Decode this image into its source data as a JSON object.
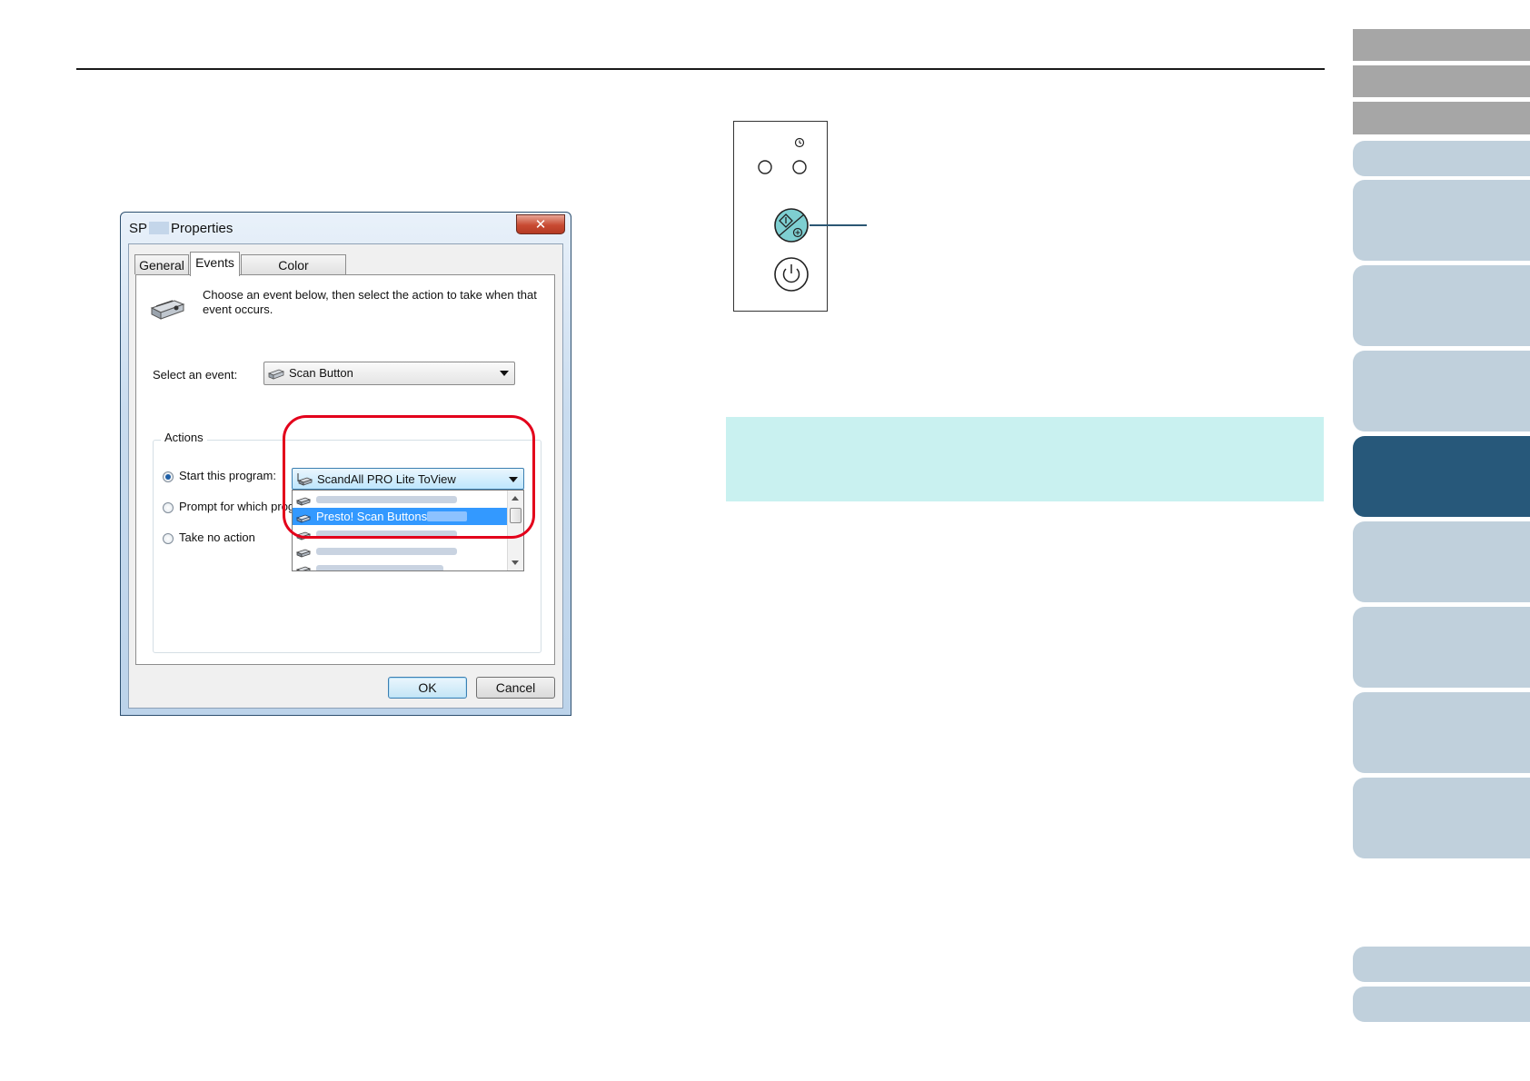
{
  "dialog": {
    "title_prefix": "SP",
    "title_suffix": "Properties",
    "close_label": "✕",
    "tabs": [
      {
        "label": "General"
      },
      {
        "label": "Events"
      },
      {
        "label": "Color Management"
      }
    ],
    "description": "Choose an event below, then select the action to take when that event occurs.",
    "select_event_label": "Select an event:",
    "event_value": "Scan Button",
    "actions_legend": "Actions",
    "radio_start": "Start this program:",
    "radio_prompt": "Prompt for which prog",
    "radio_none": "Take no action",
    "program_value": "ScandAll PRO Lite ToView",
    "dropdown_selected": "Presto! Scan Buttons",
    "ok_label": "OK",
    "cancel_label": "Cancel"
  },
  "colors": {
    "highlight_ring": "#e3001b",
    "note_background": "#c9f1f0",
    "nav_active": "#27587a",
    "nav_inactive": "#c0d0dc",
    "nav_gray": "#a6a6a6"
  },
  "icons": {
    "scanner": "scanner-icon",
    "start_button": "scan-start-icon",
    "power_button": "power-icon"
  }
}
